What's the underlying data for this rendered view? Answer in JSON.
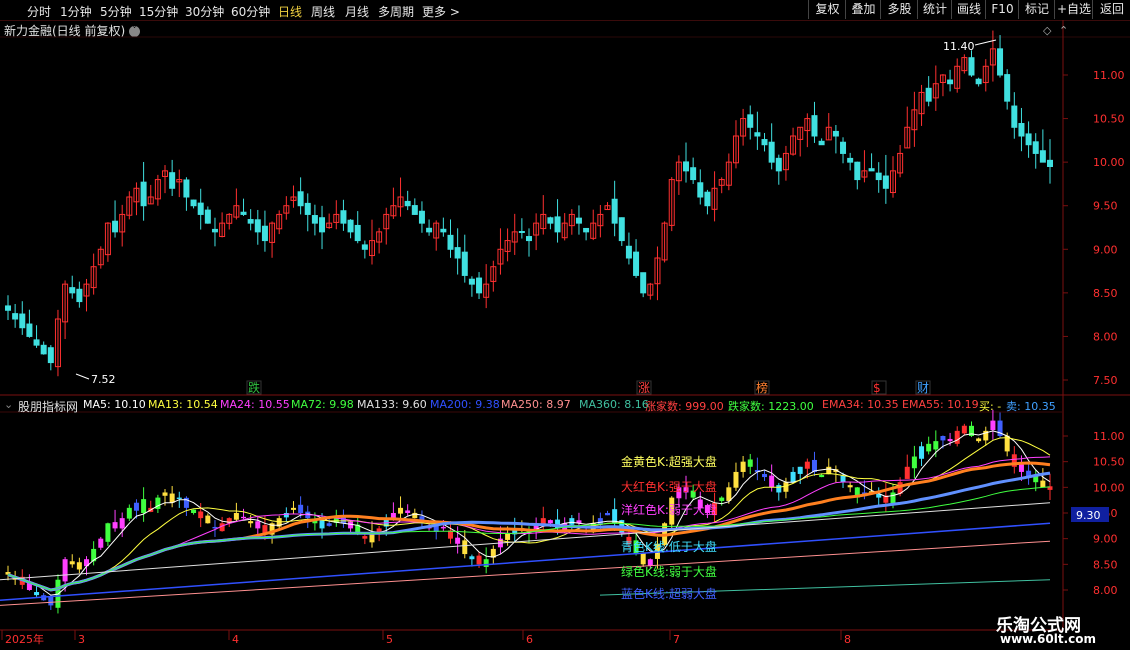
{
  "toolbar": {
    "periods": [
      "分时",
      "1分钟",
      "5分钟",
      "15分钟",
      "30分钟",
      "60分钟",
      "日线",
      "周线",
      "月线",
      "多周期",
      "更多 >"
    ],
    "active_period": "日线",
    "right_buttons": [
      "复权",
      "叠加",
      "多股",
      "统计",
      "画线",
      "F10",
      "标记",
      "+自选",
      "返回"
    ]
  },
  "main_chart": {
    "title": "新力金融(日线 前复权)",
    "high_label": "11.40",
    "low_label": "7.52",
    "price_ticks": [
      "11.00",
      "10.50",
      "10.00",
      "9.50",
      "9.00",
      "8.50",
      "8.00",
      "7.50"
    ],
    "markers": [
      {
        "text": "跌",
        "color": "#30c040"
      },
      {
        "text": "涨",
        "color": "#ff4040"
      },
      {
        "text": "榜",
        "color": "#ff8030"
      },
      {
        "text": "$",
        "color": "#ff3030"
      },
      {
        "text": "财",
        "color": "#40a0ff"
      }
    ]
  },
  "sub_chart": {
    "indicator_name": "股朋指标网",
    "legend": [
      {
        "text": "MA5: 10.10",
        "color": "#ffffff"
      },
      {
        "text": "MA13: 10.54",
        "color": "#ffff40"
      },
      {
        "text": "MA24: 10.55",
        "color": "#ff40ff"
      },
      {
        "text": "MA72: 9.98",
        "color": "#40ff40"
      },
      {
        "text": "MA133: 9.60",
        "color": "#e0e0e0"
      },
      {
        "text": "MA200: 9.38",
        "color": "#3050ff"
      },
      {
        "text": "MA250: 8.97",
        "color": "#ff9090"
      },
      {
        "text": "MA360: 8.16",
        "color": "#40c0a0"
      },
      {
        "text": "涨家数: 999.00",
        "color": "#ff4040"
      },
      {
        "text": "跌家数: 1223.00",
        "color": "#40ff40"
      },
      {
        "text": "EMA34: 10.35",
        "color": "#ff4040"
      },
      {
        "text": "EMA55: 10.19",
        "color": "#ff4040"
      },
      {
        "text": "买: -",
        "color": "#ffff40"
      },
      {
        "text": "卖: 10.35",
        "color": "#40a0ff"
      }
    ],
    "annotations": [
      {
        "text": "金黄色K:超强大盘",
        "color": "#ffff60"
      },
      {
        "text": "大红色K:强于大盘",
        "color": "#ff3030"
      },
      {
        "text": "洋红色K:弱于大盘",
        "color": "#ff40ff"
      },
      {
        "text": "青色K线:低于大盘",
        "color": "#40e0ff"
      },
      {
        "text": "绿色K线:弱于大盘",
        "color": "#40ff40"
      },
      {
        "text": "蓝色K线:超弱大盘",
        "color": "#4060ff"
      }
    ],
    "price_ticks": [
      "11.00",
      "10.50",
      "10.00",
      "9.50",
      "9.00",
      "8.50",
      "8.00"
    ],
    "current_value": "9.30"
  },
  "x_axis": {
    "labels": [
      "2025年",
      "3",
      "4",
      "5",
      "6",
      "7",
      "8"
    ]
  },
  "watermark": {
    "name": "乐淘公式网",
    "url": "www.60lt.com"
  },
  "colors": {
    "up": "#ff3030",
    "down": "#40e0e0",
    "grid": "#7a1010",
    "axis_text": "#ff3030"
  }
}
